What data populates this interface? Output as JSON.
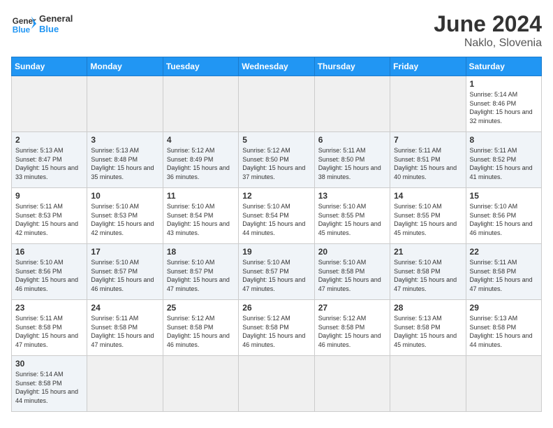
{
  "header": {
    "logo_general": "General",
    "logo_blue": "Blue",
    "month_year": "June 2024",
    "location": "Naklo, Slovenia"
  },
  "weekdays": [
    "Sunday",
    "Monday",
    "Tuesday",
    "Wednesday",
    "Thursday",
    "Friday",
    "Saturday"
  ],
  "weeks": [
    [
      {
        "day": "",
        "info": ""
      },
      {
        "day": "",
        "info": ""
      },
      {
        "day": "",
        "info": ""
      },
      {
        "day": "",
        "info": ""
      },
      {
        "day": "",
        "info": ""
      },
      {
        "day": "",
        "info": ""
      },
      {
        "day": "1",
        "info": "Sunrise: 5:14 AM\nSunset: 8:46 PM\nDaylight: 15 hours\nand 32 minutes."
      }
    ],
    [
      {
        "day": "2",
        "info": "Sunrise: 5:13 AM\nSunset: 8:47 PM\nDaylight: 15 hours\nand 33 minutes."
      },
      {
        "day": "3",
        "info": "Sunrise: 5:13 AM\nSunset: 8:48 PM\nDaylight: 15 hours\nand 35 minutes."
      },
      {
        "day": "4",
        "info": "Sunrise: 5:12 AM\nSunset: 8:49 PM\nDaylight: 15 hours\nand 36 minutes."
      },
      {
        "day": "5",
        "info": "Sunrise: 5:12 AM\nSunset: 8:50 PM\nDaylight: 15 hours\nand 37 minutes."
      },
      {
        "day": "6",
        "info": "Sunrise: 5:11 AM\nSunset: 8:50 PM\nDaylight: 15 hours\nand 38 minutes."
      },
      {
        "day": "7",
        "info": "Sunrise: 5:11 AM\nSunset: 8:51 PM\nDaylight: 15 hours\nand 40 minutes."
      },
      {
        "day": "8",
        "info": "Sunrise: 5:11 AM\nSunset: 8:52 PM\nDaylight: 15 hours\nand 41 minutes."
      }
    ],
    [
      {
        "day": "9",
        "info": "Sunrise: 5:11 AM\nSunset: 8:53 PM\nDaylight: 15 hours\nand 42 minutes."
      },
      {
        "day": "10",
        "info": "Sunrise: 5:10 AM\nSunset: 8:53 PM\nDaylight: 15 hours\nand 42 minutes."
      },
      {
        "day": "11",
        "info": "Sunrise: 5:10 AM\nSunset: 8:54 PM\nDaylight: 15 hours\nand 43 minutes."
      },
      {
        "day": "12",
        "info": "Sunrise: 5:10 AM\nSunset: 8:54 PM\nDaylight: 15 hours\nand 44 minutes."
      },
      {
        "day": "13",
        "info": "Sunrise: 5:10 AM\nSunset: 8:55 PM\nDaylight: 15 hours\nand 45 minutes."
      },
      {
        "day": "14",
        "info": "Sunrise: 5:10 AM\nSunset: 8:55 PM\nDaylight: 15 hours\nand 45 minutes."
      },
      {
        "day": "15",
        "info": "Sunrise: 5:10 AM\nSunset: 8:56 PM\nDaylight: 15 hours\nand 46 minutes."
      }
    ],
    [
      {
        "day": "16",
        "info": "Sunrise: 5:10 AM\nSunset: 8:56 PM\nDaylight: 15 hours\nand 46 minutes."
      },
      {
        "day": "17",
        "info": "Sunrise: 5:10 AM\nSunset: 8:57 PM\nDaylight: 15 hours\nand 46 minutes."
      },
      {
        "day": "18",
        "info": "Sunrise: 5:10 AM\nSunset: 8:57 PM\nDaylight: 15 hours\nand 47 minutes."
      },
      {
        "day": "19",
        "info": "Sunrise: 5:10 AM\nSunset: 8:57 PM\nDaylight: 15 hours\nand 47 minutes."
      },
      {
        "day": "20",
        "info": "Sunrise: 5:10 AM\nSunset: 8:58 PM\nDaylight: 15 hours\nand 47 minutes."
      },
      {
        "day": "21",
        "info": "Sunrise: 5:10 AM\nSunset: 8:58 PM\nDaylight: 15 hours\nand 47 minutes."
      },
      {
        "day": "22",
        "info": "Sunrise: 5:11 AM\nSunset: 8:58 PM\nDaylight: 15 hours\nand 47 minutes."
      }
    ],
    [
      {
        "day": "23",
        "info": "Sunrise: 5:11 AM\nSunset: 8:58 PM\nDaylight: 15 hours\nand 47 minutes."
      },
      {
        "day": "24",
        "info": "Sunrise: 5:11 AM\nSunset: 8:58 PM\nDaylight: 15 hours\nand 47 minutes."
      },
      {
        "day": "25",
        "info": "Sunrise: 5:12 AM\nSunset: 8:58 PM\nDaylight: 15 hours\nand 46 minutes."
      },
      {
        "day": "26",
        "info": "Sunrise: 5:12 AM\nSunset: 8:58 PM\nDaylight: 15 hours\nand 46 minutes."
      },
      {
        "day": "27",
        "info": "Sunrise: 5:12 AM\nSunset: 8:58 PM\nDaylight: 15 hours\nand 46 minutes."
      },
      {
        "day": "28",
        "info": "Sunrise: 5:13 AM\nSunset: 8:58 PM\nDaylight: 15 hours\nand 45 minutes."
      },
      {
        "day": "29",
        "info": "Sunrise: 5:13 AM\nSunset: 8:58 PM\nDaylight: 15 hours\nand 44 minutes."
      }
    ],
    [
      {
        "day": "30",
        "info": "Sunrise: 5:14 AM\nSunset: 8:58 PM\nDaylight: 15 hours\nand 44 minutes."
      },
      {
        "day": "",
        "info": ""
      },
      {
        "day": "",
        "info": ""
      },
      {
        "day": "",
        "info": ""
      },
      {
        "day": "",
        "info": ""
      },
      {
        "day": "",
        "info": ""
      },
      {
        "day": "",
        "info": ""
      }
    ]
  ]
}
